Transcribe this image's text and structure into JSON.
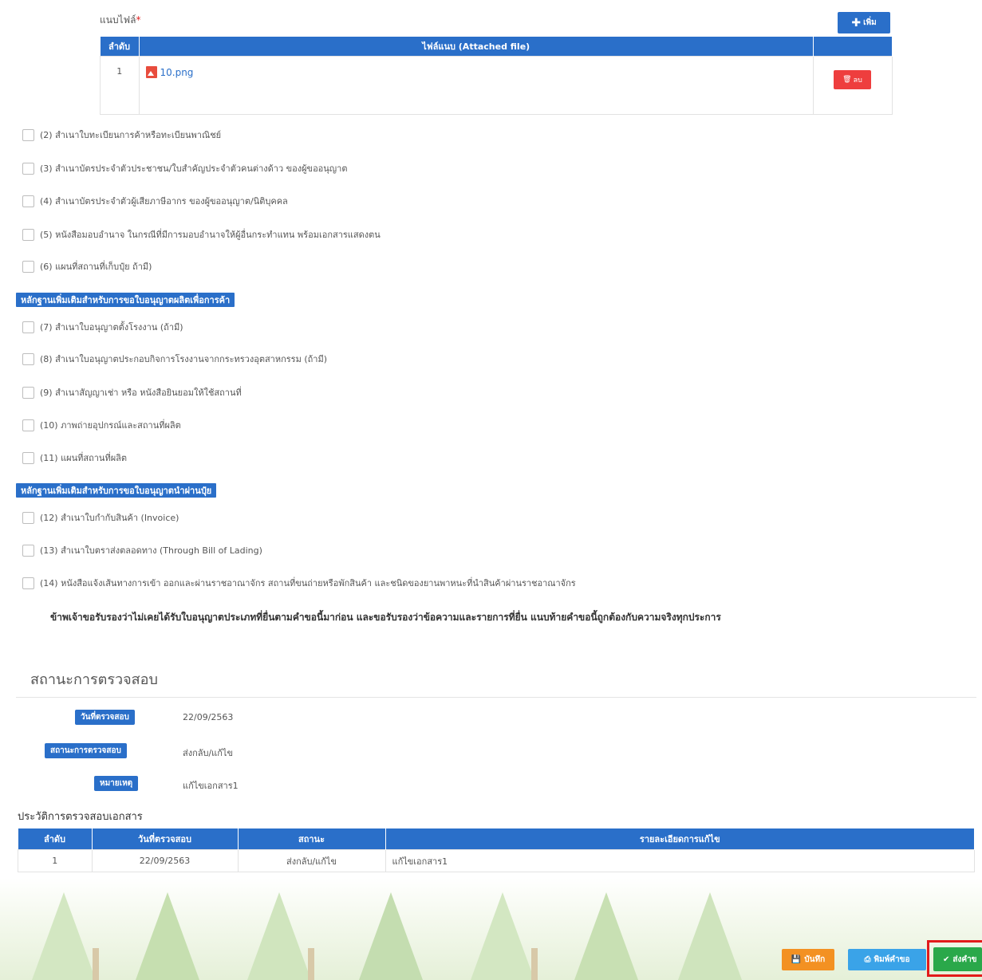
{
  "attachment": {
    "label": "แนบไฟล์",
    "required_mark": "*",
    "add_label": "เพิ่ม",
    "col_no": "ลำดับ",
    "col_file": "ไฟล์แนบ (Attached file)",
    "rows": [
      {
        "no": "1",
        "file": "10.png",
        "delete_label": "ลบ"
      }
    ]
  },
  "checklist": {
    "group1": [
      "(2) สำเนาใบทะเบียนการค้าหรือทะเบียนพาณิชย์",
      "(3) สำเนาบัตรประจำตัวประชาชน/ใบสำคัญประจำตัวคนต่างด้าว ของผู้ขออนุญาต",
      "(4) สำเนาบัตรประจำตัวผู้เสียภาษีอากร ของผู้ขออนุญาต/นิติบุคคล",
      "(5) หนังสือมอบอำนาจ ในกรณีที่มีการมอบอำนาจให้ผู้อื่นกระทำแทน พร้อมเอกสารแสดงตน",
      "(6) แผนที่สถานที่เก็บปุ๋ย ถ้ามี)"
    ],
    "section2": "หลักฐานเพิ่มเติมสำหรับการขอใบอนุญาตผลิตเพื่อการค้า",
    "group2": [
      "(7) สำเนาใบอนุญาตตั้งโรงงาน (ถ้ามี)",
      "(8) สำเนาใบอนุญาตประกอบกิจการโรงงานจากกระทรวงอุตสาหกรรม (ถ้ามี)",
      "(9) สำเนาสัญญาเช่า หรือ หนังสือยินยอมให้ใช้สถานที่",
      "(10) ภาพถ่ายอุปกรณ์และสถานที่ผลิต",
      "(11) แผนที่สถานที่ผลิต"
    ],
    "section3": "หลักฐานเพิ่มเติมสำหรับการขอใบอนุญาตนำผ่านปุ๋ย",
    "group3": [
      "(12) สำเนาใบกำกับสินค้า (Invoice)",
      "(13) สำเนาใบตราส่งตลอดทาง (Through Bill of Lading)",
      "(14) หนังสือแจ้งเส้นทางการเข้า ออกและผ่านราชอาณาจักร สถานที่ขนถ่ายหรือพักสินค้า และชนิดของยานพาหนะที่นำสินค้าผ่านราชอาณาจักร"
    ]
  },
  "declaration": "ข้าพเจ้าขอรับรองว่าไม่เคยได้รับใบอนุญาตประเภทที่ยื่นตามคำขอนี้มาก่อน และขอรับรองว่าข้อความและรายการที่ยื่น แนบท้ายคำขอนี้ถูกต้องกับความจริงทุกประการ",
  "status": {
    "title": "สถานะการตรวจสอบ",
    "check_date_label": "วันที่ตรวจสอบ",
    "check_date": "22/09/2563",
    "status_label": "สถานะการตรวจสอบ",
    "status_value": "ส่งกลับ/แก้ไข",
    "note_label": "หมายเหตุ",
    "note_value": "แก้ไขเอกสาร1"
  },
  "history": {
    "title": "ประวัติการตรวจสอบเอกสาร",
    "columns": [
      "ลำดับ",
      "วันที่ตรวจสอบ",
      "สถานะ",
      "รายละเอียดการแก้ไข"
    ],
    "rows": [
      {
        "no": "1",
        "date": "22/09/2563",
        "status": "ส่งกลับ/แก้ไข",
        "detail": "แก้ไขเอกสาร1"
      }
    ]
  },
  "actions": {
    "save_label": "บันทึก",
    "print_label": "พิมพ์คำขอ",
    "submit_label": "ส่งคำข"
  },
  "colors": {
    "primary": "#2a6fc9",
    "danger": "#ee3e3e",
    "save": "#f39122",
    "print": "#3aa3e8",
    "submit": "#2aa84a",
    "highlight": "#e21b1b"
  }
}
